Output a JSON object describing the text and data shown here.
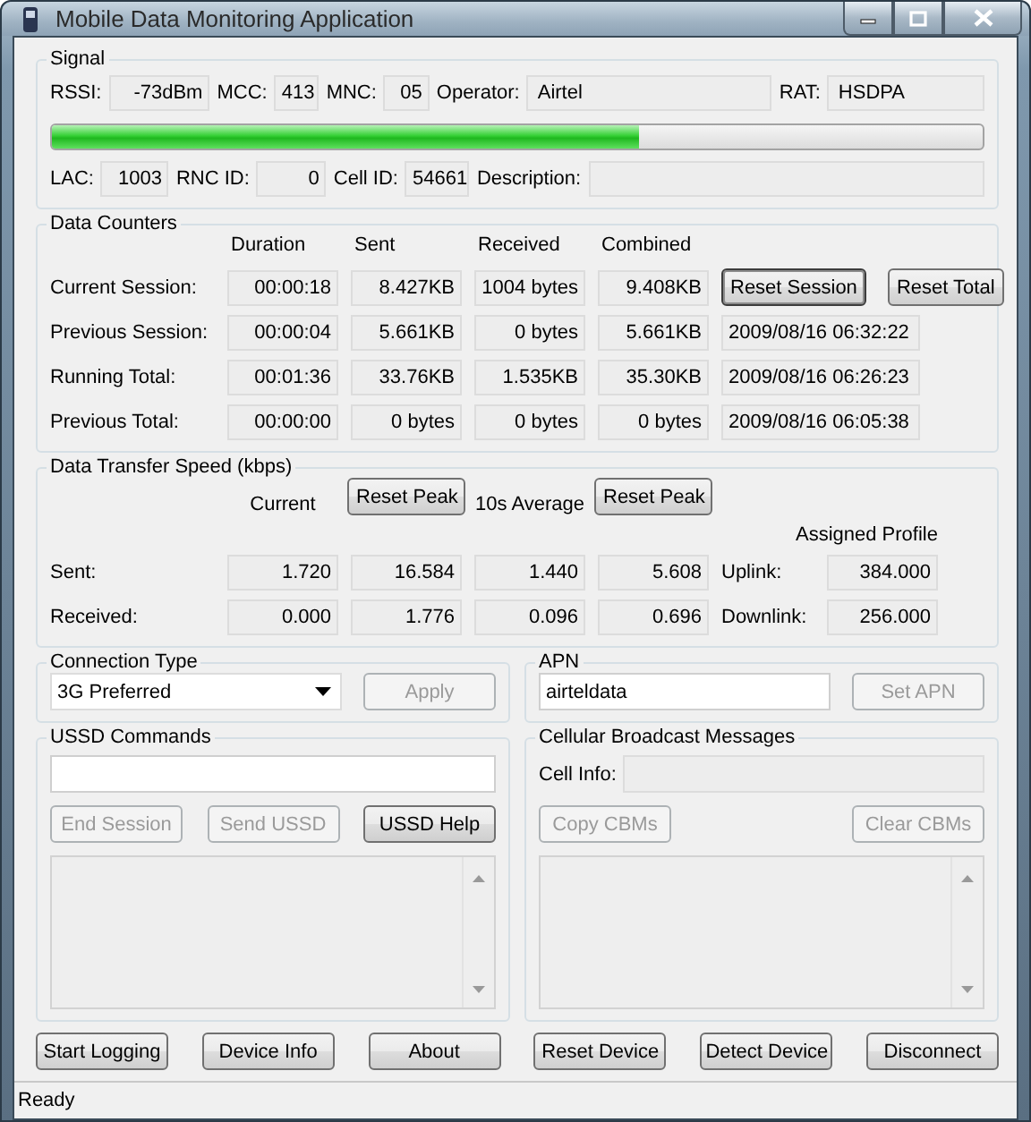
{
  "window": {
    "title": "Mobile Data Monitoring Application"
  },
  "signal": {
    "title": "Signal",
    "row_1": [
      {
        "label": "RSSI:",
        "value": "-73dBm"
      },
      {
        "label": "MCC:",
        "value": "413"
      },
      {
        "label": "MNC:",
        "value": "05"
      },
      {
        "label": "Operator:",
        "value": "Airtel"
      },
      {
        "label": "RAT:",
        "value": "HSDPA"
      }
    ],
    "level": 0.63,
    "row_2": [
      {
        "label": "LAC:",
        "value": "1003"
      },
      {
        "label": "RNC ID:",
        "value": "0"
      },
      {
        "label": "Cell ID:",
        "value": "54661"
      },
      {
        "label": "Description:"
      }
    ]
  },
  "data_counters": {
    "title": "Data Counters",
    "columns": [
      "Duration",
      "Sent",
      "Received",
      "Combined"
    ],
    "rows": [
      {
        "label": "Current Session:",
        "values": [
          "00:00:18",
          "8.427KB",
          "1004 bytes",
          "9.408KB"
        ],
        "kind": "buttons",
        "buttons": [
          "Reset Session",
          "Reset Total"
        ]
      },
      {
        "label": "Previous Session:",
        "values": [
          "00:00:04",
          "5.661KB",
          "0 bytes",
          "5.661KB"
        ],
        "kind": "timestamp",
        "timestamp": "2009/08/16 06:32:22"
      },
      {
        "label": "Running Total:",
        "values": [
          "00:01:36",
          "33.76KB",
          "1.535KB",
          "35.30KB"
        ],
        "kind": "timestamp",
        "timestamp": "2009/08/16 06:26:23"
      },
      {
        "label": "Previous Total:",
        "values": [
          "00:00:00",
          "0 bytes",
          "0 bytes",
          "0 bytes"
        ],
        "kind": "timestamp",
        "timestamp": "2009/08/16 06:05:38"
      }
    ]
  },
  "speed": {
    "title": "Data Transfer Speed (kbps)",
    "headers": [
      {
        "kind": "text",
        "label": "Current"
      },
      {
        "kind": "button",
        "label": "Reset Peak"
      },
      {
        "kind": "text",
        "label": "10s Average"
      },
      {
        "kind": "button",
        "label": "Reset Peak"
      }
    ],
    "profile_header": "Assigned Profile",
    "rows": [
      {
        "label": "Sent:",
        "values": [
          "1.720",
          "16.584",
          "1.440",
          "5.608"
        ],
        "profile_label": "Uplink:",
        "profile_value": "384.000"
      },
      {
        "label": "Received:",
        "values": [
          "0.000",
          "1.776",
          "0.096",
          "0.696"
        ],
        "profile_label": "Downlink:",
        "profile_value": "256.000"
      }
    ]
  },
  "connection_type": {
    "title": "Connection Type",
    "value": "3G Preferred",
    "button": {
      "label": "Apply",
      "disabled": true
    }
  },
  "apn": {
    "title": "APN",
    "value": "airteldata",
    "button": {
      "label": "Set APN",
      "disabled": true
    }
  },
  "ussd": {
    "title": "USSD Commands",
    "buttons": [
      {
        "label": "End Session",
        "disabled": true
      },
      {
        "label": "Send USSD",
        "disabled": true
      },
      {
        "label": "USSD Help",
        "disabled": false
      }
    ]
  },
  "cbm": {
    "title": "Cellular Broadcast Messages",
    "cell_info_label": "Cell Info:",
    "buttons": [
      {
        "label": "Copy CBMs",
        "disabled": true
      },
      {
        "label": "Clear CBMs",
        "disabled": true
      }
    ]
  },
  "bottom_buttons": [
    "Start Logging",
    "Device Info",
    "About",
    "Reset Device",
    "Detect Device",
    "Disconnect"
  ],
  "status_bar": "Ready"
}
